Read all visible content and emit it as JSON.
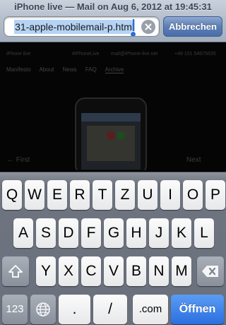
{
  "header": {
    "title": "iPhone live — Mail on Aug 6, 2012 at 19:45:31",
    "url_value": "31-apple-mobilemail-p.html",
    "cancel_label": "Abbrechen"
  },
  "webpage": {
    "logo": "iPhone live",
    "hashtag": "#iPhoneLive",
    "mail": "mail@iPhone-live.net",
    "phone": "+49 151 54675635",
    "nav": [
      "Manifesto",
      "About",
      "News",
      "FAQ",
      "Archive"
    ],
    "first": "← First",
    "next": "Next"
  },
  "keyboard": {
    "row1": [
      "Q",
      "W",
      "E",
      "R",
      "T",
      "Z",
      "U",
      "I",
      "O",
      "P"
    ],
    "row2": [
      "A",
      "S",
      "D",
      "F",
      "G",
      "H",
      "J",
      "K",
      "L"
    ],
    "row3": [
      "Y",
      "X",
      "C",
      "V",
      "B",
      "N",
      "M"
    ],
    "num_label": "123",
    "dot": ".",
    "slash": "/",
    "dotcom": ".com",
    "go_label": "Öffnen",
    "shift_icon": "shift-arrow",
    "delete_icon": "backspace",
    "globe_icon": "globe"
  },
  "colors": {
    "accent_blue": "#2b6fe0",
    "selection": "#b5d3f4"
  }
}
